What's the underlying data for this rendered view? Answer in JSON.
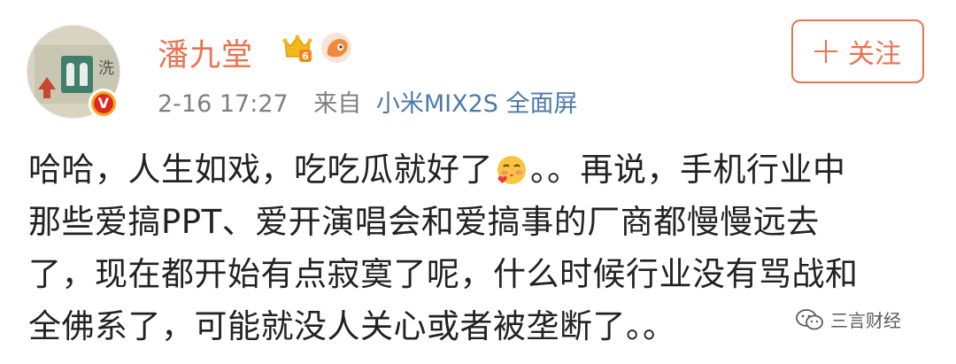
{
  "user": {
    "name": "潘九堂",
    "vip_level": "6",
    "verified_mark": "V"
  },
  "meta": {
    "time": "2-16 17:27",
    "from_label": "来自",
    "device": "小米MIX2S 全面屏"
  },
  "follow_button": {
    "label": "关注"
  },
  "post": {
    "line1_before_emoji": "哈哈，人生如戏，吃吃瓜就好了",
    "line1_after_emoji": "。。再说，手机行业中",
    "line2": "那些爱搞PPT、爱开演唱会和爱搞事的厂商都慢慢远去",
    "line3": "了，现在都开始有点寂寞了呢，什么时候行业没有骂战和",
    "line4": "全佛系了，可能就没人关心或者被垄断了。。"
  },
  "avatar": {
    "sign_text": "洗"
  },
  "watermark": {
    "text": "三言财经"
  },
  "colors": {
    "brand_orange": "#eb7350",
    "device_link": "#4d7aa8",
    "meta_gray": "#7f7f7f",
    "body_text": "#222222"
  },
  "icons": {
    "vip": "crown-icon",
    "fan": "fox-icon",
    "emoji": "kiss-blush-emoji-icon",
    "follow": "plus-icon",
    "watermark": "wechat-icon"
  }
}
